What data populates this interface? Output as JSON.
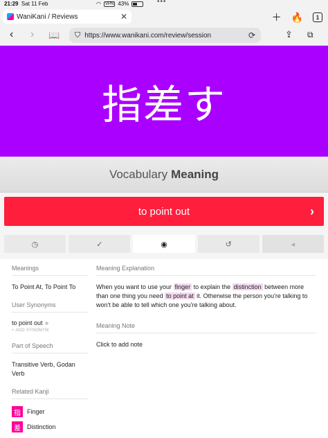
{
  "statusbar": {
    "time": "21:29",
    "date": "Sat 11 Feb",
    "vpn": "VPN",
    "battery": "43%",
    "battery_level": 0.43
  },
  "tab": {
    "title": "WaniKani / Reviews",
    "count": "1"
  },
  "address": {
    "url": "https://www.wanikani.com/review/session"
  },
  "review": {
    "character": "指差す",
    "prompt_type": "Vocabulary",
    "prompt_kind": "Meaning",
    "answer": "to point out"
  },
  "buttons": [
    {
      "name": "clock-icon"
    },
    {
      "name": "checkmark-icon"
    },
    {
      "name": "eye-icon"
    },
    {
      "name": "undo-icon"
    },
    {
      "name": "arrow-left-icon"
    }
  ],
  "info": {
    "meanings_label": "Meanings",
    "meanings_value": "To Point At, To Point To",
    "synonyms_label": "User Synonyms",
    "synonym_value": "to point out",
    "add_synonym": "+ ADD SYNONYM",
    "pos_label": "Part of Speech",
    "pos_value": "Transitive Verb, Godan Verb",
    "related_kanji_label": "Related Kanji",
    "kanji": [
      {
        "char": "指",
        "meaning": "Finger"
      },
      {
        "char": "差",
        "meaning": "Distinction"
      }
    ],
    "explanation_label": "Meaning Explanation",
    "explanation_parts": {
      "p1": "When you want to use your ",
      "h1": "finger",
      "p2": " to explain the ",
      "h2": "distinction",
      "p3": " between more than one thing you need ",
      "h3": "to point at",
      "p4": " it. Otherwise the person you're talking to won't be able to tell which one you're talking about."
    },
    "note_label": "Meaning Note",
    "note_value": "Click to add note"
  },
  "colors": {
    "vocab": "#aa00ff",
    "incorrect": "#ff1f3d",
    "kanji": "#ff0099"
  }
}
